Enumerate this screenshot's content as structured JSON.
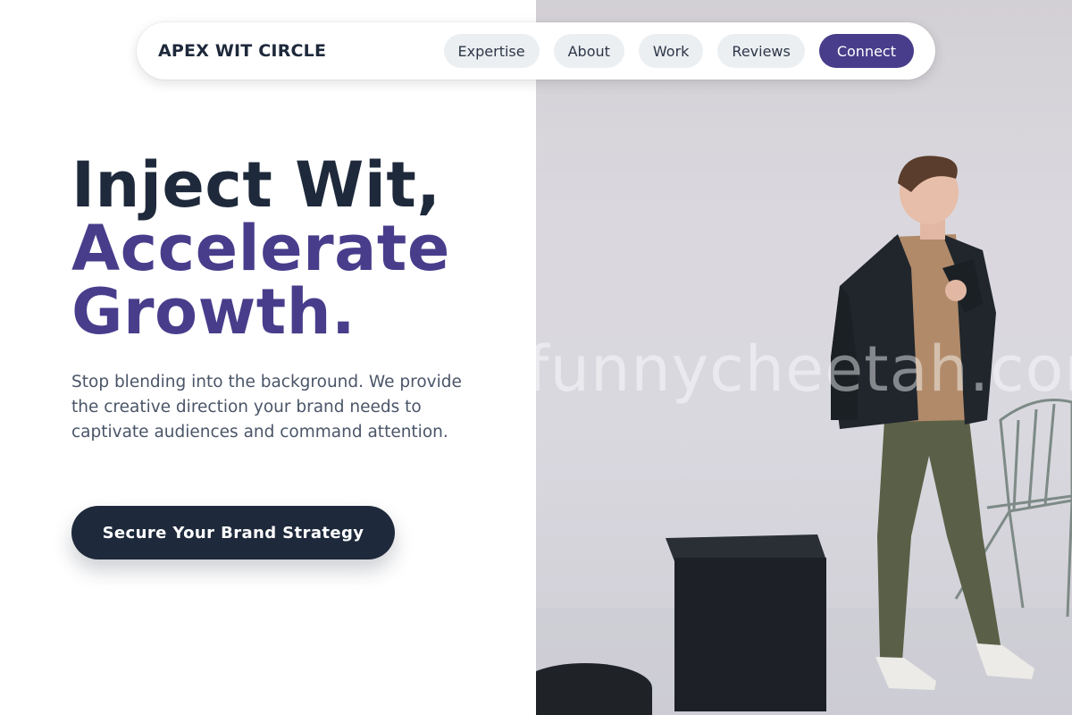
{
  "brand": {
    "name": "APEX WIT CIRCLE"
  },
  "nav": {
    "links": [
      {
        "label": "Expertise"
      },
      {
        "label": "About"
      },
      {
        "label": "Work"
      },
      {
        "label": "Reviews"
      }
    ],
    "cta": {
      "label": "Connect",
      "color": "#483d8b"
    }
  },
  "hero": {
    "headline_line1": "Inject Wit,",
    "headline_line2": "Accelerate",
    "headline_line3": "Growth.",
    "subcopy": "Stop blending into the background. We provide the creative direction your brand needs to captivate audiences and command attention.",
    "cta_label": "Secure Your Brand Strategy"
  },
  "photo": {
    "watermark": "funnycheetah.com",
    "subject": "man in dark blazer, tan shirt, olive trousers standing in studio beside a chair and black box"
  },
  "colors": {
    "dark": "#1e293b",
    "accent": "#483d8b",
    "body_text": "#4a5568",
    "pill_bg": "#eceff2"
  }
}
